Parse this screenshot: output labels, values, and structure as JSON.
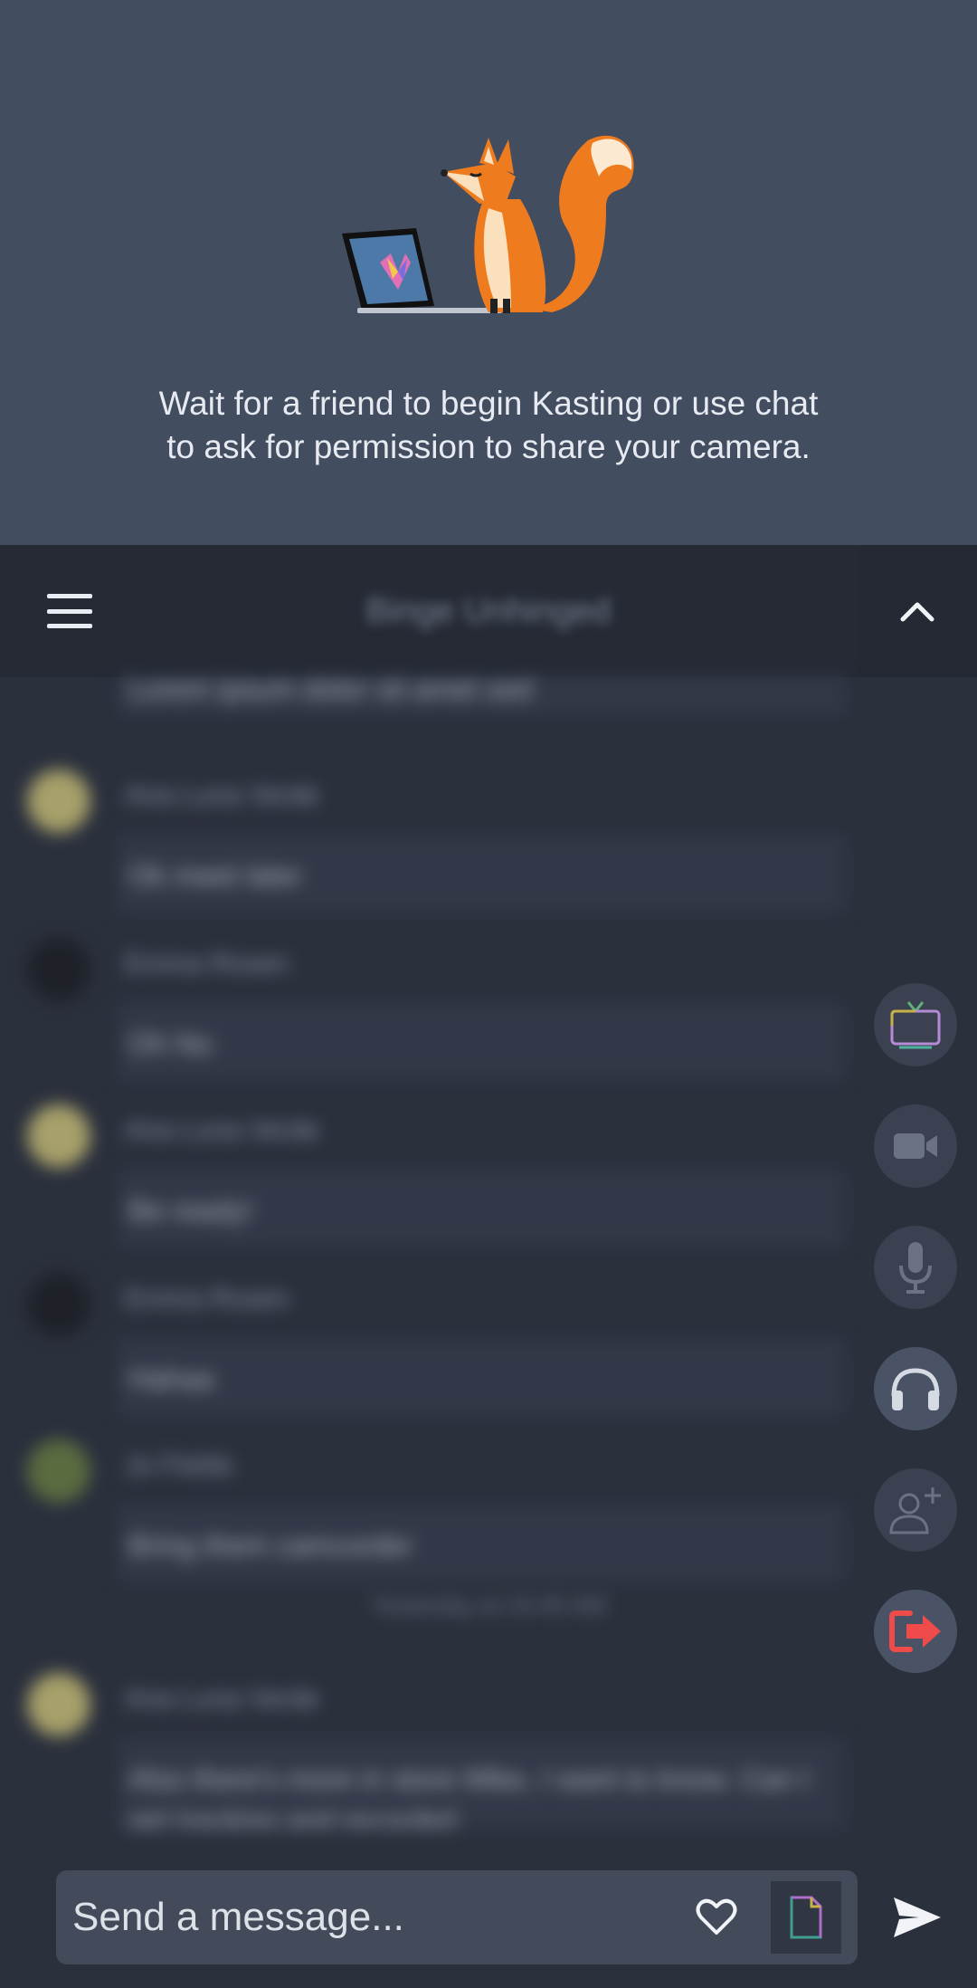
{
  "waiting": {
    "message": "Wait for a friend to begin Kasting or use chat to ask for permission to share your camera."
  },
  "header": {
    "room_title": "Binge Unhinged"
  },
  "messages": [
    {
      "name": "",
      "text": "Lorem ipsum dolor sit amet sed"
    },
    {
      "name": "Ana Luna Verde",
      "text": "Ok meet later"
    },
    {
      "name": "Emma Rosen",
      "text": "Oh No"
    },
    {
      "name": "Ana Luna Verde",
      "text": "Be ready!"
    },
    {
      "name": "Emma Rosen",
      "text": "Hahaa"
    },
    {
      "name": "Jo Fields",
      "text": "Bring them camcorder"
    },
    {
      "name": "Ana Luna Verde",
      "text": "Also there's more in store Mike, I want to know. Can I get tracking and recorded"
    }
  ],
  "divider": {
    "label": "Yesterday at 10:45 AM"
  },
  "composer": {
    "placeholder": "Send a message..."
  },
  "colors": {
    "top_bg": "#434d60",
    "chat_bg": "#2b303d",
    "header_bg": "#252a35",
    "leave_red": "#ef4b4b"
  }
}
